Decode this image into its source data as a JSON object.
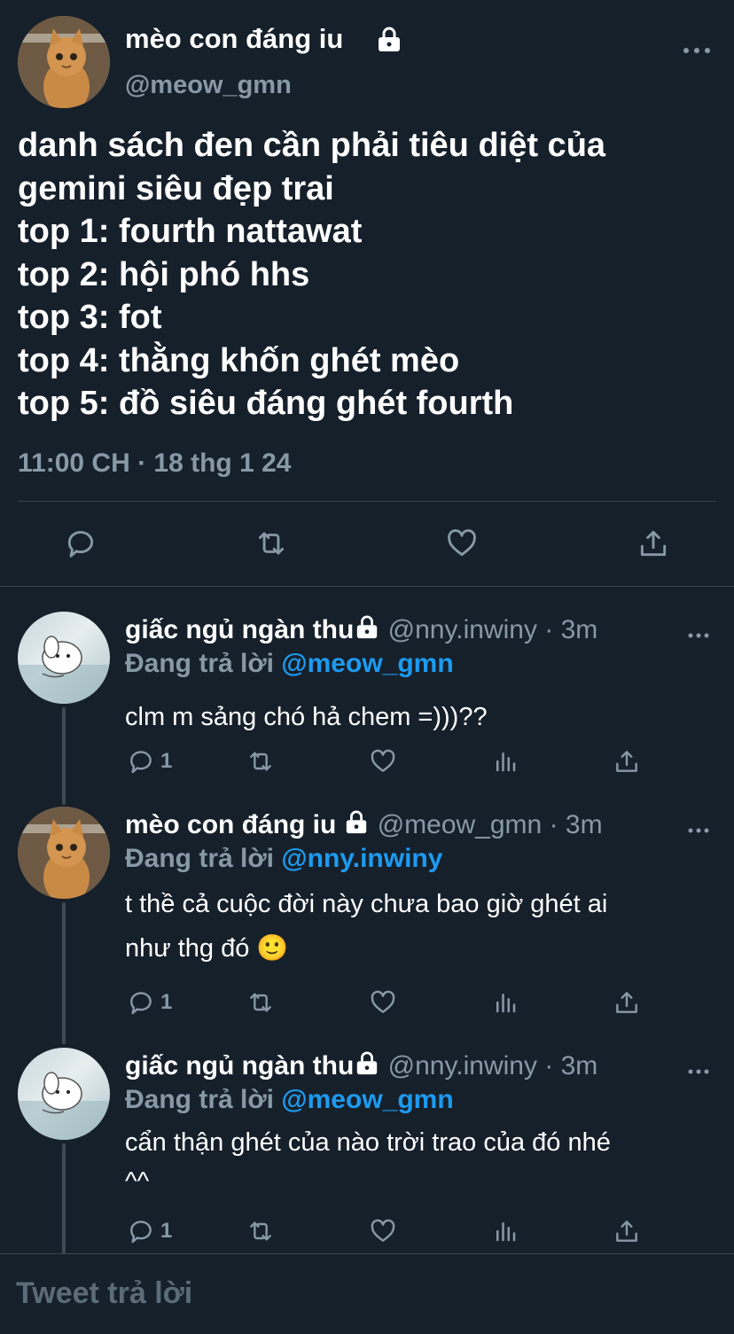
{
  "main_tweet": {
    "display_name": "mèo con đáng iu",
    "handle": "@meow_gmn",
    "text_lines": [
      "danh sách đen cần phải tiêu diệt của",
      "gemini siêu đẹp trai",
      "top 1: fourth nattawat",
      "top 2: hội phó hhs",
      "top 3: fot",
      "top 4: thằng khốn ghét mèo",
      "top 5: đồ siêu đáng ghét fourth"
    ],
    "timestamp": "11:00 CH · 18 thg 1 24"
  },
  "replies": [
    {
      "display_name": "giấc ngủ ngàn thu",
      "handle": "@nny.inwiny",
      "time": "· 3m",
      "replying_prefix": "Đang trả lời",
      "replying_to": "@meow_gmn",
      "text_lines": [
        "clm m sảng chó hả chem =)))??"
      ],
      "reply_count": "1"
    },
    {
      "display_name": "mèo con đáng iu",
      "handle": "@meow_gmn",
      "time": "· 3m",
      "replying_prefix": "Đang trả lời",
      "replying_to": "@nny.inwiny",
      "text_lines": [
        "t thề cả cuộc đời này chưa bao giờ ghét ai",
        "như thg đó 🙂"
      ],
      "reply_count": "1"
    },
    {
      "display_name": "giấc ngủ ngàn thu",
      "handle": "@nny.inwiny",
      "time": "· 3m",
      "replying_prefix": "Đang trả lời",
      "replying_to": "@meow_gmn",
      "text_lines": [
        "cẩn thận ghét của nào trời trao của đó nhé",
        "^^"
      ],
      "reply_count": "1"
    }
  ],
  "compose": {
    "placeholder": "Tweet trả lời"
  },
  "colors": {
    "background": "#16202b",
    "link": "#1d9bf0",
    "muted": "#8899a6",
    "divider": "#38444d"
  }
}
